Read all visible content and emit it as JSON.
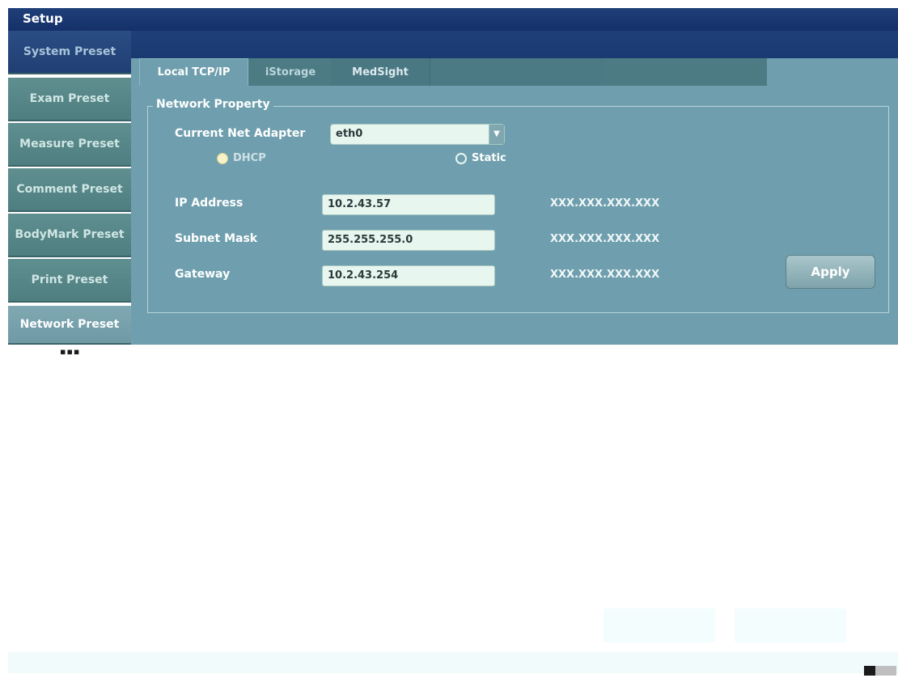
{
  "window": {
    "title": "Setup"
  },
  "sidebar": {
    "items": [
      {
        "label": "System Preset"
      },
      {
        "label": "Exam Preset"
      },
      {
        "label": "Measure Preset"
      },
      {
        "label": "Comment Preset"
      },
      {
        "label": "BodyMark Preset"
      },
      {
        "label": "Print Preset"
      },
      {
        "label": "Network Preset",
        "active": true
      }
    ]
  },
  "tabs": [
    {
      "label": "Local TCP/IP",
      "active": true
    },
    {
      "label": "iStorage"
    },
    {
      "label": "MedSight"
    }
  ],
  "network": {
    "group_title": "Network Property",
    "adapter_label": "Current Net Adapter",
    "adapter_value": "eth0",
    "mode_dhcp": "DHCP",
    "mode_static": "Static",
    "mode_selected": "Static",
    "ip_label": "IP Address",
    "ip_value": "10.2.43.57",
    "mask_label": "Subnet Mask",
    "mask_value": "255.255.255.0",
    "gateway_label": "Gateway",
    "gateway_value": "10.2.43.254",
    "format_hint": "XXX.XXX.XXX.XXX",
    "apply_label": "Apply"
  },
  "icons": {
    "dropdown": "chevron-down-icon"
  },
  "colors": {
    "titlebar": "#1f3f78",
    "panel": "#6f9fae",
    "input_bg": "#e7f6ef"
  }
}
